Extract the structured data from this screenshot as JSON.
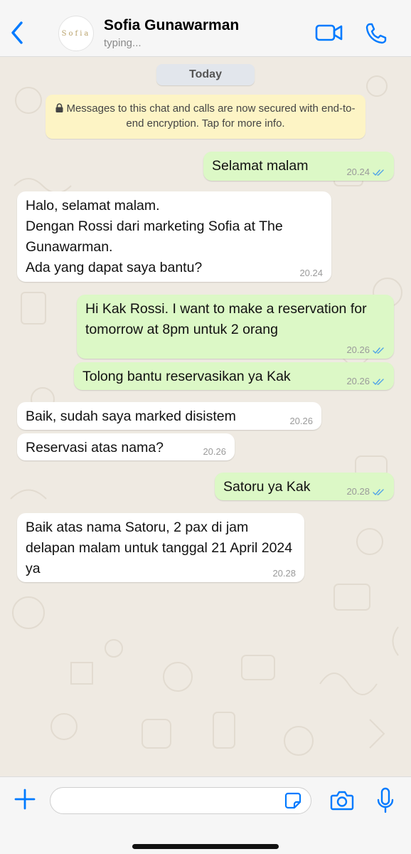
{
  "header": {
    "contact_name": "Sofia Gunawarman",
    "status": "typing...",
    "avatar_text": "Sofia"
  },
  "chat": {
    "date_label": "Today",
    "encryption_notice": "Messages to this chat and calls are now secured with end-to-end encryption. Tap for more info.",
    "messages": [
      {
        "direction": "out",
        "text": "Selamat malam",
        "time": "20.24",
        "read": true
      },
      {
        "direction": "in",
        "text": "Halo, selamat malam.\nDengan Rossi dari marketing Sofia at The Gunawarman.\nAda yang dapat saya bantu?",
        "time": "20.24"
      },
      {
        "direction": "out",
        "text": "Hi Kak Rossi. I want to make a reservation for tomorrow at 8pm untuk 2 orang",
        "time": "20.26",
        "read": true
      },
      {
        "direction": "out",
        "text": "Tolong bantu reservasikan ya Kak",
        "time": "20.26",
        "read": true
      },
      {
        "direction": "in",
        "text": "Baik, sudah saya marked disistem",
        "time": "20.26"
      },
      {
        "direction": "in",
        "text": "Reservasi atas nama?",
        "time": "20.26"
      },
      {
        "direction": "out",
        "text": "Satoru ya Kak",
        "time": "20.28",
        "read": true
      },
      {
        "direction": "in",
        "text": "Baik atas nama Satoru, 2 pax di jam delapan malam untuk tanggal 21 April 2024 ya",
        "time": "20.28"
      }
    ]
  },
  "input": {
    "value": "",
    "placeholder": ""
  },
  "icons": {
    "back": "chevron-left-icon",
    "video": "video-camera-icon",
    "call": "phone-icon",
    "lock": "lock-icon",
    "read_receipt": "double-check-icon",
    "attach": "plus-icon",
    "sticker": "sticker-icon",
    "camera": "camera-icon",
    "mic": "microphone-icon"
  },
  "colors": {
    "accent": "#007aff",
    "outgoing_bubble": "#dcf8c6",
    "incoming_bubble": "#ffffff",
    "encryption_banner": "#fdf4c5",
    "chat_background": "#efeae2",
    "read_tick": "#4fa3e8"
  }
}
